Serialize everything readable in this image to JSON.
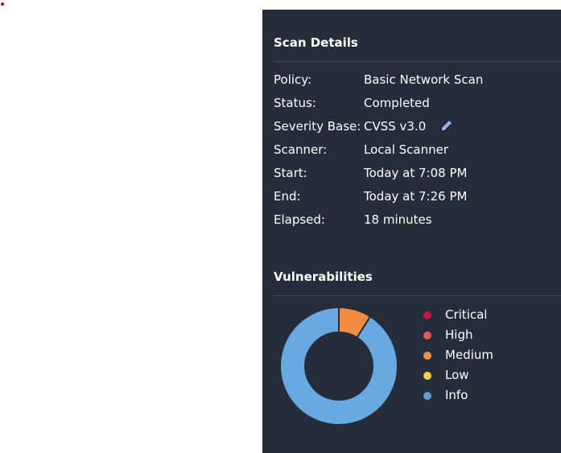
{
  "scan_details": {
    "title": "Scan Details",
    "rows": [
      {
        "label": "Policy:",
        "value": "Basic Network Scan"
      },
      {
        "label": "Status:",
        "value": "Completed"
      },
      {
        "label": "Severity Base:",
        "value": "CVSS v3.0"
      },
      {
        "label": "Scanner:",
        "value": "Local Scanner"
      },
      {
        "label": "Start:",
        "value": "Today at 7:08 PM"
      },
      {
        "label": "End:",
        "value": "Today at 7:26 PM"
      },
      {
        "label": "Elapsed:",
        "value": "18 minutes"
      }
    ],
    "edit_icon": "pencil-icon"
  },
  "vulnerabilities": {
    "title": "Vulnerabilities",
    "legend": [
      {
        "label": "Critical",
        "color": "#c8173f"
      },
      {
        "label": "High",
        "color": "#e9574f"
      },
      {
        "label": "Medium",
        "color": "#f28c43"
      },
      {
        "label": "Low",
        "color": "#f8d23f"
      },
      {
        "label": "Info",
        "color": "#5a9fd8"
      }
    ]
  },
  "chart_data": {
    "type": "pie",
    "categories": [
      "Critical",
      "High",
      "Medium",
      "Low",
      "Info"
    ],
    "values": [
      0,
      0,
      9,
      0,
      91
    ],
    "colors": [
      "#c8173f",
      "#e9574f",
      "#f28c43",
      "#f8d23f",
      "#67a9e0"
    ]
  }
}
